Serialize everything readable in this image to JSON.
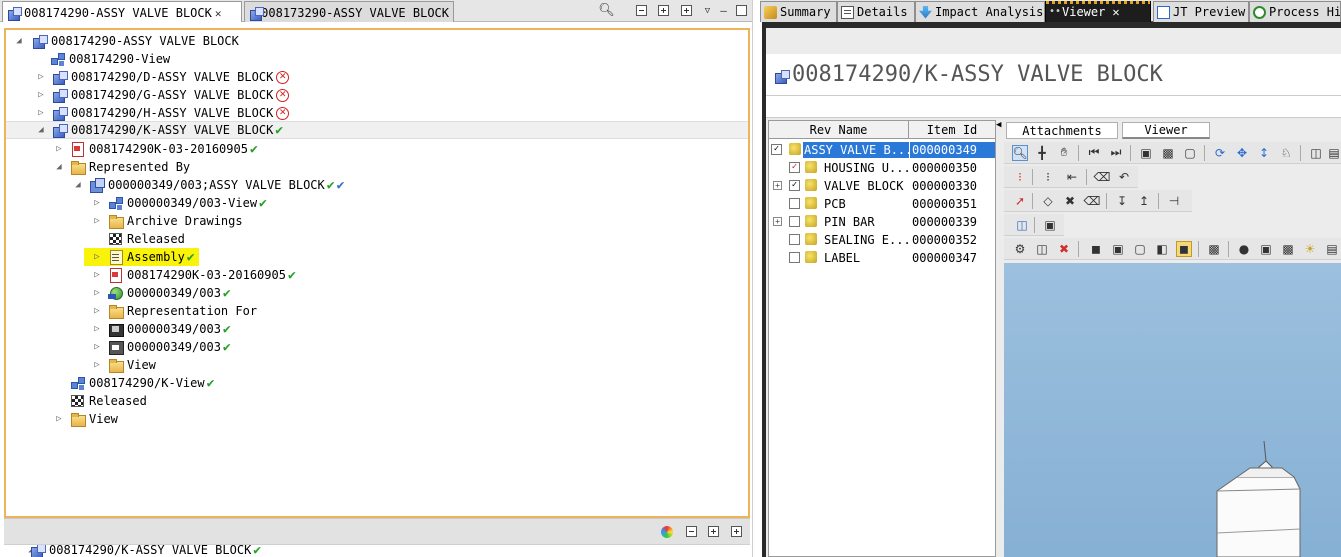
{
  "left_tabs": [
    {
      "label": "008174290-ASSY VALVE BLOCK",
      "close": "✕"
    },
    {
      "label": "008173290-ASSY VALVE BLOCK"
    }
  ],
  "tree": [
    {
      "label": "008174290-ASSY VALVE BLOCK",
      "icon": "assembly-icon"
    },
    {
      "label": "008174290-View",
      "icon": "bom-view-icon"
    },
    {
      "label": "008174290/D-ASSY VALVE BLOCK",
      "icon": "assembly-revision-icon",
      "status": "error"
    },
    {
      "label": "008174290/G-ASSY VALVE BLOCK",
      "icon": "assembly-revision-icon",
      "status": "error"
    },
    {
      "label": "008174290/H-ASSY VALVE BLOCK",
      "icon": "assembly-revision-icon",
      "status": "error"
    },
    {
      "label": "008174290/K-ASSY VALVE BLOCK",
      "icon": "assembly-revision-icon",
      "status": "released",
      "selected": true
    },
    {
      "label": "008174290K-03-20160905",
      "icon": "pdf-icon",
      "status": "released"
    },
    {
      "label": "Represented By",
      "icon": "folder-icon"
    },
    {
      "label": "000000349/003;ASSY VALVE BLOCK",
      "icon": "part-revision-icon",
      "status": "released-and-checked"
    },
    {
      "label": "000000349/003-View",
      "icon": "bom-view-icon",
      "status": "released"
    },
    {
      "label": "Archive Drawings",
      "icon": "folder-icon"
    },
    {
      "label": "Released",
      "icon": "release-status-icon"
    },
    {
      "label": "Assembly",
      "icon": "document-icon",
      "status": "released",
      "highlighted": true
    },
    {
      "label": "008174290K-03-20160905",
      "icon": "pdf-icon",
      "status": "released"
    },
    {
      "label": "000000349/003",
      "icon": "cad-model-icon",
      "status": "released"
    },
    {
      "label": "Representation For",
      "icon": "folder-icon"
    },
    {
      "label": "000000349/003",
      "icon": "drawing-icon",
      "status": "released"
    },
    {
      "label": "000000349/003",
      "icon": "dataset-icon",
      "status": "released"
    },
    {
      "label": "View",
      "icon": "folder-icon"
    },
    {
      "label": "008174290/K-View",
      "icon": "bom-view-icon",
      "status": "released"
    },
    {
      "label": "Released",
      "icon": "release-status-icon"
    },
    {
      "label": "View",
      "icon": "folder-icon"
    }
  ],
  "bottom_tree_item": "008174290/K-ASSY VALVE BLOCK",
  "right_tabs": [
    {
      "label": "Summary",
      "icon": "summary-icon"
    },
    {
      "label": "Details",
      "icon": "details-icon"
    },
    {
      "label": "Impact Analysis",
      "icon": "impact-analysis-icon"
    },
    {
      "label": "Viewer",
      "icon": "viewer-icon",
      "active": true,
      "close": "✕"
    },
    {
      "label": "JT Preview",
      "icon": "jt-preview-icon"
    },
    {
      "label": "Process Hi",
      "icon": "process-history-icon"
    }
  ],
  "object_title": "008174290/K-ASSY VALVE BLOCK",
  "bom_table": {
    "headers": [
      "Rev Name",
      "Item Id"
    ],
    "rows": [
      {
        "name": "ASSY VALVE B...",
        "id": "000000349",
        "check": "✓",
        "selected": true
      },
      {
        "name": "HOUSING U...",
        "id": "000000350",
        "check": "✓"
      },
      {
        "name": "VALVE BLOCK",
        "id": "000000330",
        "check": "✓",
        "expandable": true
      },
      {
        "name": "PCB",
        "id": "000000351",
        "check": ""
      },
      {
        "name": "PIN BAR",
        "id": "000000339",
        "check": "",
        "expandable": true
      },
      {
        "name": "SEALING E...",
        "id": "000000352",
        "check": ""
      },
      {
        "name": "LABEL",
        "id": "000000347",
        "check": ""
      }
    ]
  },
  "viewer_tabs": [
    "Attachments",
    "Viewer"
  ],
  "colors": {
    "accent_orange": "#f0b25a",
    "selection_blue": "#2a79d8",
    "highlight_yellow": "#f9f20a",
    "released_green": "#24a024",
    "error_red": "#d42020",
    "viewport_blue": "#9cc0de"
  }
}
